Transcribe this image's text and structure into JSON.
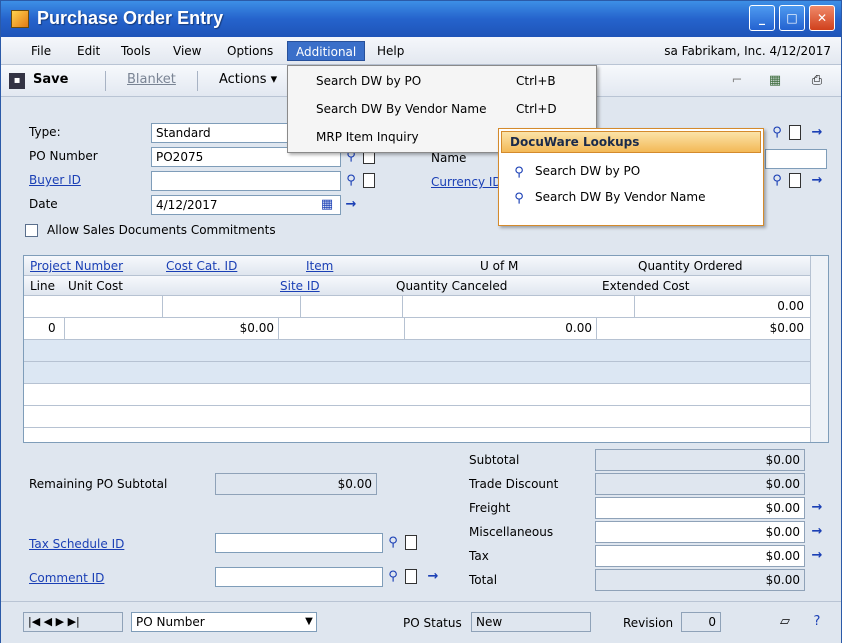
{
  "window": {
    "title": "Purchase Order Entry",
    "min": "_",
    "max": "□",
    "close": "✕"
  },
  "menubar": {
    "items": [
      "File",
      "Edit",
      "Tools",
      "View",
      "Options",
      "Additional",
      "Help"
    ],
    "company": "sa  Fabrikam, Inc.  4/12/2017"
  },
  "toolbar": {
    "save": "Save",
    "blanket": "Blanket",
    "actions": "Actions ▾"
  },
  "form": {
    "type_label": "Type:",
    "type_value": "Standard",
    "po_label": "PO Number",
    "po_value": "PO2075",
    "buyer_label": "Buyer ID",
    "buyer_value": "",
    "date_label": "Date",
    "date_value": "4/12/2017",
    "allow_label": "Allow Sales Documents Commitments",
    "name_label": "Name",
    "currency_label": "Currency ID"
  },
  "grid": {
    "head1": {
      "project": "Project Number",
      "costcat": "Cost Cat. ID",
      "item": "Item",
      "uom": "U of M",
      "qty_ordered": "Quantity Ordered"
    },
    "head2": {
      "line": "Line",
      "unit_cost": "Unit Cost",
      "site": "Site ID",
      "qty_canceled": "Quantity Canceled",
      "ext_cost": "Extended Cost"
    },
    "rows": [
      {
        "ext": "0.00"
      },
      {
        "line": "0",
        "unit": "$0.00",
        "qty": "0.00",
        "ext": "$0.00"
      }
    ]
  },
  "totals": {
    "remaining_label": "Remaining PO Subtotal",
    "remaining_value": "$0.00",
    "subtotal_label": "Subtotal",
    "subtotal": "$0.00",
    "trade_label": "Trade Discount",
    "trade": "$0.00",
    "freight_label": "Freight",
    "freight": "$0.00",
    "misc_label": "Miscellaneous",
    "misc": "$0.00",
    "tax_label": "Tax",
    "tax": "$0.00",
    "total_label": "Total",
    "total": "$0.00",
    "taxsched_label": "Tax Schedule ID",
    "comment_label": "Comment ID"
  },
  "statusbar": {
    "sort": "PO Number",
    "status_label": "PO Status",
    "status_value": "New",
    "revision_label": "Revision",
    "revision_value": "0"
  },
  "dropdown": {
    "items": [
      {
        "label": "Search DW by PO",
        "shortcut": "Ctrl+B"
      },
      {
        "label": "Search DW By Vendor Name",
        "shortcut": "Ctrl+D"
      },
      {
        "label": "MRP Item Inquiry",
        "shortcut": ""
      }
    ]
  },
  "flyout": {
    "title": "DocuWare Lookups",
    "items": [
      "Search DW by PO",
      "Search DW By Vendor Name"
    ]
  }
}
